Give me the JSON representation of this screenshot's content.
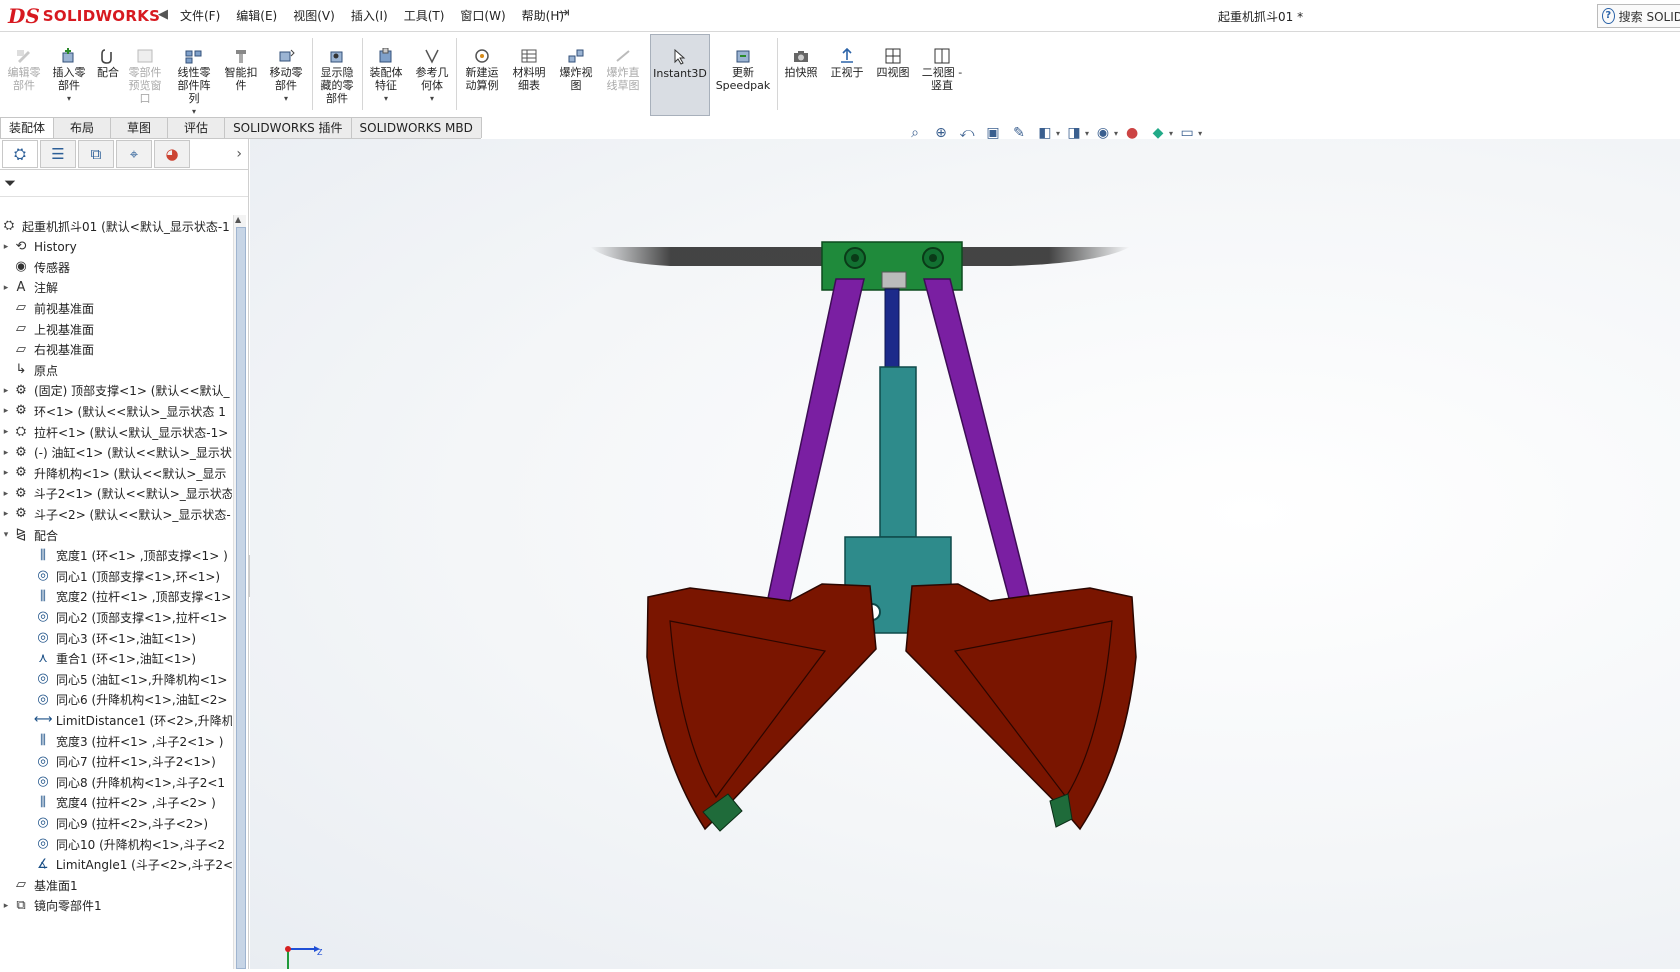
{
  "titlebar": {
    "logo_ds": "DS",
    "logo_name": "SOLIDWORKS",
    "menu": [
      "文件(F)",
      "编辑(E)",
      "视图(V)",
      "插入(I)",
      "工具(T)",
      "窗口(W)",
      "帮助(H)"
    ],
    "document_title": "起重机抓斗01 *",
    "search_label": "搜索 SOLID"
  },
  "commands": {
    "edit_component": "编辑零\n部件",
    "insert_component": "插入零\n部件",
    "mate": "配合",
    "component_preview": "零部件\n预览窗\n口",
    "linear_pattern": "线性零\n部件阵\n列",
    "smart_fasteners": "智能扣\n件",
    "move_component": "移动零\n部件",
    "show_hidden": "显示隐\n藏的零\n部件",
    "assembly_features": "装配体\n特征",
    "reference_geometry": "参考几\n何体",
    "new_motion_study": "新建运\n动算例",
    "bom": "材料明\n细表",
    "exploded_view": "爆炸视\n图",
    "explode_line_sketch": "爆炸直\n线草图",
    "instant3d": "Instant3D",
    "update_speedpak": "更新\nSpeedpak",
    "snapshot": "拍快照",
    "normal_to": "正视于",
    "four_view": "四视图",
    "two_view": "二视图 -\n竖直"
  },
  "tabs": [
    "装配体",
    "布局",
    "草图",
    "评估",
    "SOLIDWORKS 插件",
    "SOLIDWORKS MBD"
  ],
  "tree": {
    "root": "起重机抓斗01  (默认<默认_显示状态-1",
    "items": [
      {
        "label": "History",
        "icon": "history-icon",
        "exp": "▸"
      },
      {
        "label": "传感器",
        "icon": "sensor-icon",
        "exp": ""
      },
      {
        "label": "注解",
        "icon": "annotation-icon",
        "exp": "▸"
      },
      {
        "label": "前视基准面",
        "icon": "plane-icon",
        "exp": ""
      },
      {
        "label": "上视基准面",
        "icon": "plane-icon",
        "exp": ""
      },
      {
        "label": "右视基准面",
        "icon": "plane-icon",
        "exp": ""
      },
      {
        "label": "原点",
        "icon": "origin-icon",
        "exp": ""
      },
      {
        "label": "(固定) 顶部支撑<1> (默认<<默认_",
        "icon": "part-icon",
        "exp": "▸"
      },
      {
        "label": "环<1> (默认<<默认>_显示状态 1",
        "icon": "part-icon",
        "exp": "▸"
      },
      {
        "label": "拉杆<1> (默认<默认_显示状态-1>",
        "icon": "subassembly-icon",
        "exp": "▸"
      },
      {
        "label": "(-) 油缸<1> (默认<<默认>_显示状",
        "icon": "part-icon",
        "exp": "▸"
      },
      {
        "label": "升降机构<1> (默认<<默认>_显示",
        "icon": "part-icon",
        "exp": "▸"
      },
      {
        "label": "斗子2<1> (默认<<默认>_显示状态",
        "icon": "part-icon",
        "exp": "▸"
      },
      {
        "label": "斗子<2> (默认<<默认>_显示状态-",
        "icon": "part-icon",
        "exp": "▸"
      },
      {
        "label": "配合",
        "icon": "mates-folder-icon",
        "exp": "▾"
      }
    ],
    "mates": [
      {
        "label": "宽度1 (环<1> ,顶部支撑<1> )",
        "icon": "width-mate-icon"
      },
      {
        "label": "同心1 (顶部支撑<1>,环<1>)",
        "icon": "concentric-mate-icon"
      },
      {
        "label": "宽度2 (拉杆<1> ,顶部支撑<1>",
        "icon": "width-mate-icon"
      },
      {
        "label": "同心2 (顶部支撑<1>,拉杆<1>",
        "icon": "concentric-mate-icon"
      },
      {
        "label": "同心3 (环<1>,油缸<1>)",
        "icon": "concentric-mate-icon"
      },
      {
        "label": "重合1 (环<1>,油缸<1>)",
        "icon": "coincident-mate-icon"
      },
      {
        "label": "同心5 (油缸<1>,升降机构<1>",
        "icon": "concentric-mate-icon"
      },
      {
        "label": "同心6 (升降机构<1>,油缸<2>",
        "icon": "concentric-mate-icon"
      },
      {
        "label": "LimitDistance1 (环<2>,升降机",
        "icon": "limit-distance-icon"
      },
      {
        "label": "宽度3 (拉杆<1> ,斗子2<1> )",
        "icon": "width-mate-icon"
      },
      {
        "label": "同心7 (拉杆<1>,斗子2<1>)",
        "icon": "concentric-mate-icon"
      },
      {
        "label": "同心8 (升降机构<1>,斗子2<1",
        "icon": "concentric-mate-icon"
      },
      {
        "label": "宽度4 (拉杆<2> ,斗子<2> )",
        "icon": "width-mate-icon"
      },
      {
        "label": "同心9 (拉杆<2>,斗子<2>)",
        "icon": "concentric-mate-icon"
      },
      {
        "label": "同心10 (升降机构<1>,斗子<2",
        "icon": "concentric-mate-icon"
      },
      {
        "label": "LimitAngle1 (斗子<2>,斗子2<",
        "icon": "limit-angle-icon"
      }
    ],
    "after": [
      {
        "label": "基准面1",
        "icon": "plane-icon",
        "exp": ""
      },
      {
        "label": "镜向零部件1",
        "icon": "mirror-component-icon",
        "exp": "▸"
      }
    ]
  },
  "colors": {
    "brand_red": "#d71920",
    "support_green": "#1f8a3b",
    "arm_purple": "#7a1fa2",
    "cylinder_teal": "#2e8b8b",
    "bucket_red": "#7a1500",
    "axis_x": "#1f4fd6",
    "axis_y": "#1f9a3a"
  }
}
